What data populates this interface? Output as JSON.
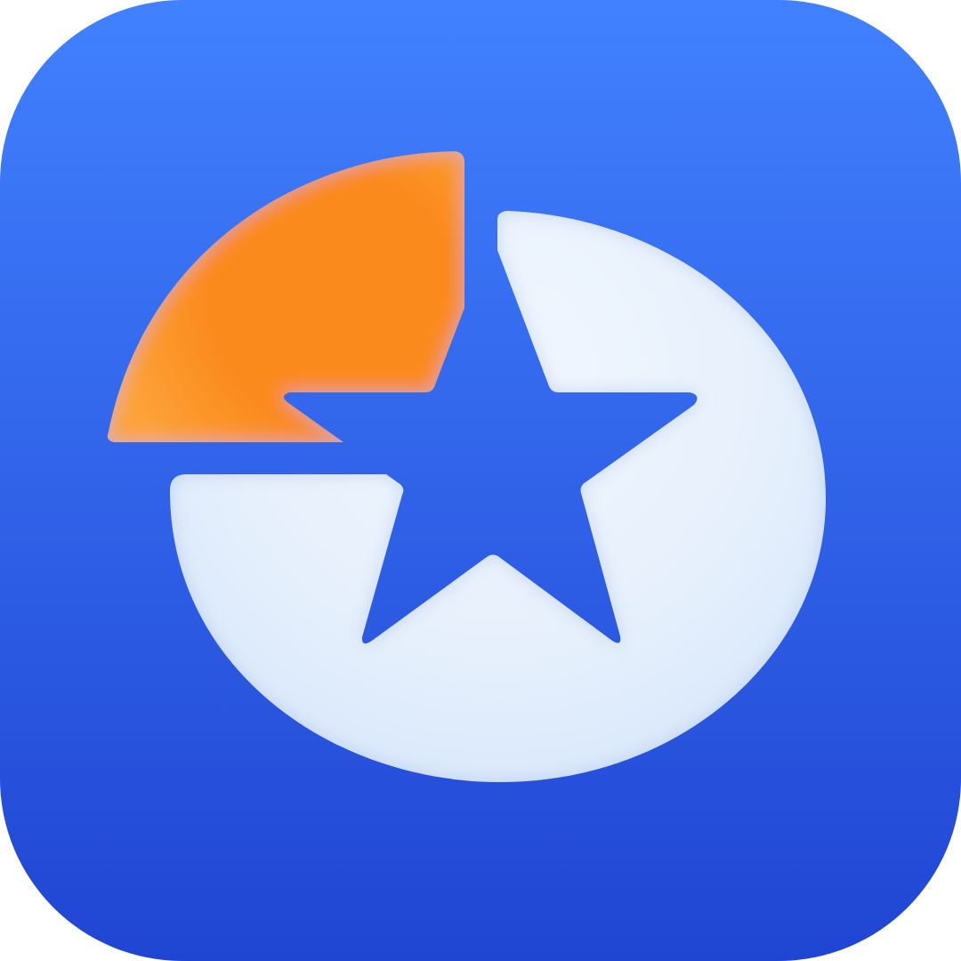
{
  "app_icon": {
    "name": "app-icon",
    "depicts": "star-pie-icon",
    "colors": {
      "background_top": "#4181FF",
      "background_bottom": "#2045D3",
      "slice_accent": "#FB8A1E",
      "slice_accent_light": "#FCA43A",
      "pie_body": "#F2F7FE",
      "pie_body_shade": "#D6E6FA"
    }
  }
}
